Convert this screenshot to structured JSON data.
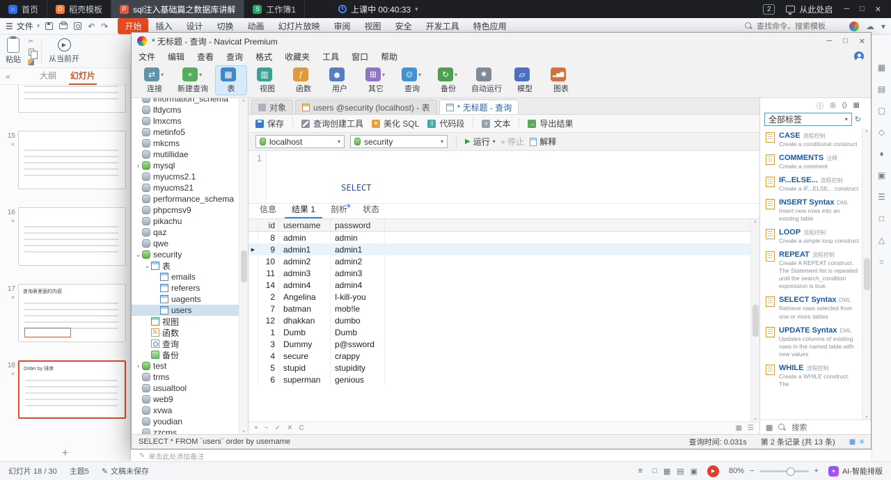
{
  "icons": {
    "caret_down": "▾",
    "chevron_left": "«",
    "scroll_up": "^",
    "scroll_down": "⌄",
    "pencil": "✎",
    "play": "▶",
    "stop": "■",
    "undo": "↶",
    "redo": "↷",
    "menu": "☰",
    "info": "ⓘ",
    "target": "◎",
    "brackets": "()",
    "grid": "▦",
    "list": "≡",
    "refresh": "↻",
    "close": "✕",
    "minimize": "─",
    "maximize": "□",
    "star": "★",
    "cloud": "☁",
    "scissors": "✂",
    "plus": "+"
  },
  "taskbar": {
    "tabs": [
      {
        "label": "首页",
        "icon": "home"
      },
      {
        "label": "稻壳模板",
        "icon": "docer"
      },
      {
        "label": "sql注入基础篇之数据库讲解",
        "icon": "ppt",
        "active": true
      },
      {
        "label": "工作簿1",
        "icon": "sheet"
      }
    ],
    "timer": "上课中 00:40:33",
    "badge": "2",
    "play_from_here": "从此处启"
  },
  "ribbon": {
    "file_label": "文件",
    "tabs": [
      {
        "label": "开始",
        "active": true
      },
      {
        "label": "插入"
      },
      {
        "label": "设计"
      },
      {
        "label": "切换"
      },
      {
        "label": "动画"
      },
      {
        "label": "幻灯片放映"
      },
      {
        "label": "审阅"
      },
      {
        "label": "视图"
      },
      {
        "label": "安全"
      },
      {
        "label": "开发工具"
      },
      {
        "label": "特色应用"
      }
    ],
    "search": "查找命令、搜索模板"
  },
  "wps": {
    "paste": "粘贴",
    "play_current": "从当前开",
    "outline_tab": "大纲",
    "slides_tab": "幻灯片",
    "slides": [
      {
        "number": "",
        "partial": true
      },
      {
        "number": "15"
      },
      {
        "number": "16"
      },
      {
        "number": "17",
        "title": "查询表里面的内容",
        "redbox": true
      },
      {
        "number": "18",
        "title": "Order by 排序",
        "selected": true
      }
    ],
    "add_slide": "+",
    "notes_hint": "单击此处添加备注",
    "status": {
      "counter": "幻灯片 18 / 30",
      "theme": "主题5",
      "saved": "文稿未保存",
      "zoom": "80%",
      "ai": "AI-智能排版"
    },
    "view_icons": [
      "□",
      "▦",
      "▤",
      "▣"
    ],
    "side_icons": [
      "▦",
      "▤",
      "▢",
      "◇",
      "♦",
      "▣",
      "☰",
      "□",
      "△",
      "○"
    ]
  },
  "navicat": {
    "title": "* 无标题 - 查询 - Navicat Premium",
    "menus": [
      {
        "label": "文件"
      },
      {
        "label": "编辑"
      },
      {
        "label": "查看"
      },
      {
        "label": "查询"
      },
      {
        "label": "格式"
      },
      {
        "label": "收藏夹"
      },
      {
        "label": "工具"
      },
      {
        "label": "窗口"
      },
      {
        "label": "帮助"
      }
    ],
    "toolbar": [
      {
        "label": "连接",
        "icon": "connect",
        "caret": true
      },
      {
        "label": "新建查询",
        "icon": "newquery",
        "caret": true
      },
      {
        "label": "表",
        "icon": "table",
        "active": true
      },
      {
        "label": "视图",
        "icon": "view"
      },
      {
        "label": "函数",
        "icon": "fx"
      },
      {
        "label": "用户",
        "icon": "user"
      },
      {
        "label": "其它",
        "icon": "other",
        "caret": true
      },
      {
        "label": "查询",
        "icon": "query",
        "caret": true
      },
      {
        "label": "备份",
        "icon": "backup",
        "caret": true
      },
      {
        "label": "自动运行",
        "icon": "automation"
      },
      {
        "label": "模型",
        "icon": "model"
      },
      {
        "label": "图表",
        "icon": "chart"
      }
    ],
    "tree": [
      {
        "label": "information_schema",
        "depth": 0,
        "icon": "db"
      },
      {
        "label": "lfdycms",
        "depth": 0,
        "icon": "db"
      },
      {
        "label": "lmxcms",
        "depth": 0,
        "icon": "db"
      },
      {
        "label": "metinfo5",
        "depth": 0,
        "icon": "db"
      },
      {
        "label": "mkcms",
        "depth": 0,
        "icon": "db"
      },
      {
        "label": "mutillidae",
        "depth": 0,
        "icon": "db"
      },
      {
        "label": "mysql",
        "depth": 0,
        "icon": "dbopen",
        "expand": "›"
      },
      {
        "label": "myucms2.1",
        "depth": 0,
        "icon": "db"
      },
      {
        "label": "myucms21",
        "depth": 0,
        "icon": "db"
      },
      {
        "label": "performance_schema",
        "depth": 0,
        "icon": "db"
      },
      {
        "label": "phpcmsv9",
        "depth": 0,
        "icon": "db"
      },
      {
        "label": "pikachu",
        "depth": 0,
        "icon": "db"
      },
      {
        "label": "qaz",
        "depth": 0,
        "icon": "db"
      },
      {
        "label": "qwe",
        "depth": 0,
        "icon": "db"
      },
      {
        "label": "security",
        "depth": 0,
        "icon": "dbopen",
        "expand": "⌄"
      },
      {
        "label": "表",
        "depth": 1,
        "icon": "tables",
        "expand": "⌄"
      },
      {
        "label": "emails",
        "depth": 2,
        "icon": "table"
      },
      {
        "label": "referers",
        "depth": 2,
        "icon": "table"
      },
      {
        "label": "uagents",
        "depth": 2,
        "icon": "table"
      },
      {
        "label": "users",
        "depth": 2,
        "icon": "table",
        "selected": true
      },
      {
        "label": "视图",
        "depth": 1,
        "icon": "view"
      },
      {
        "label": "函数",
        "depth": 1,
        "icon": "fx"
      },
      {
        "label": "查询",
        "depth": 1,
        "icon": "query"
      },
      {
        "label": "备份",
        "depth": 1,
        "icon": "backup"
      },
      {
        "label": "test",
        "depth": 0,
        "icon": "dbopen",
        "expand": "›"
      },
      {
        "label": "trms",
        "depth": 0,
        "icon": "db"
      },
      {
        "label": "usualtool",
        "depth": 0,
        "icon": "db"
      },
      {
        "label": "web9",
        "depth": 0,
        "icon": "db"
      },
      {
        "label": "xvwa",
        "depth": 0,
        "icon": "db"
      },
      {
        "label": "youdian",
        "depth": 0,
        "icon": "db"
      },
      {
        "label": "zzcms",
        "depth": 0,
        "icon": "db"
      }
    ],
    "doc_tabs": [
      {
        "label": "对象",
        "icon": "objects"
      },
      {
        "label": "users @security (localhost) - 表",
        "icon": "tabletab"
      },
      {
        "label": "* 无标题 - 查询",
        "icon": "querytab",
        "active": true
      }
    ],
    "qbar": [
      {
        "label": "保存",
        "icon": "save",
        "sep_after": true
      },
      {
        "label": "查询创建工具",
        "icon": "builder"
      },
      {
        "label": "美化 SQL",
        "icon": "beautify"
      },
      {
        "label": "代码段",
        "icon": "snippet",
        "sep_after": true
      },
      {
        "label": "文本",
        "icon": "textmode",
        "caret": true,
        "sep_after": true
      },
      {
        "label": "导出结果",
        "icon": "export"
      }
    ],
    "conn": {
      "server": "localhost",
      "database": "security",
      "run": "运行",
      "stop": "停止",
      "explain": "解释"
    },
    "editor": {
      "line_no": "1",
      "tokens": [
        {
          "t": "kw",
          "v": "SELECT"
        },
        {
          "t": "kw",
          "v": " * "
        },
        {
          "t": "kw",
          "v": "FROM"
        },
        {
          "t": "id",
          "v": " `users` order by username"
        }
      ]
    },
    "result_tabs": [
      {
        "label": "信息"
      },
      {
        "label": "结果 1",
        "active": true
      },
      {
        "label": "剖析"
      },
      {
        "label": "状态"
      }
    ],
    "grid": {
      "columns": {
        "id": "id",
        "username": "username",
        "password": "password"
      },
      "rows": [
        {
          "id": "8",
          "username": "admin",
          "password": "admin"
        },
        {
          "id": "9",
          "username": "admin1",
          "password": "admin1",
          "current": true
        },
        {
          "id": "10",
          "username": "admin2",
          "password": "admin2"
        },
        {
          "id": "11",
          "username": "admin3",
          "password": "admin3"
        },
        {
          "id": "14",
          "username": "admin4",
          "password": "admin4"
        },
        {
          "id": "2",
          "username": "Angelina",
          "password": "I-kill-you"
        },
        {
          "id": "7",
          "username": "batman",
          "password": "mob!le"
        },
        {
          "id": "12",
          "username": "dhakkan",
          "password": "dumbo"
        },
        {
          "id": "1",
          "username": "Dumb",
          "password": "Dumb"
        },
        {
          "id": "3",
          "username": "Dummy",
          "password": "p@ssword"
        },
        {
          "id": "4",
          "username": "secure",
          "password": "crappy"
        },
        {
          "id": "5",
          "username": "stupid",
          "password": "stupidity"
        },
        {
          "id": "6",
          "username": "superman",
          "password": "genious"
        }
      ]
    },
    "foot_icons": [
      "+",
      "−",
      "✓",
      "✕",
      "C"
    ],
    "foot_icons_right": [
      "▦",
      "☰"
    ],
    "status": {
      "sql": "SELECT * FROM `users` order by username",
      "time": "查询时间: 0.031s",
      "record": "第 2 条记录 (共 13 条)"
    },
    "right_panel": {
      "filter": "全部标签",
      "search": "搜索",
      "snippets": [
        {
          "title": "CASE",
          "tag": "流程控制",
          "desc": "Create a conditional construct"
        },
        {
          "title": "COMMENTS",
          "tag": "注释",
          "desc": "Create a comment"
        },
        {
          "title": "IF...ELSE...",
          "tag": "流程控制",
          "desc": "Create a IF...ELSE... construct"
        },
        {
          "title": "INSERT Syntax",
          "tag": "DML",
          "desc": "Insert new rows into an existing table"
        },
        {
          "title": "LOOP",
          "tag": "流程控制",
          "desc": "Create a simple loop construct"
        },
        {
          "title": "REPEAT",
          "tag": "流程控制",
          "desc": "Create A REPEAT construct. The Statement list is repeated until the search_condition expression is true."
        },
        {
          "title": "SELECT Syntax",
          "tag": "DML",
          "desc": "Retrieve rows selected from one or more tables"
        },
        {
          "title": "UPDATE Syntax",
          "tag": "DML",
          "desc": "Updates columns of existing rows in the named table with new values"
        },
        {
          "title": "WHILE",
          "tag": "流程控制",
          "desc": "Create a WHILE construct. The"
        }
      ]
    }
  }
}
